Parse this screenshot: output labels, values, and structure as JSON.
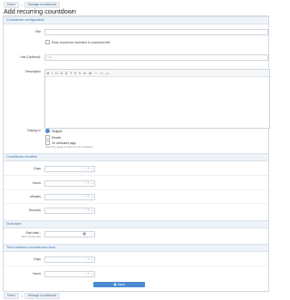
{
  "breadcrumb": {
    "home": "Home",
    "current": "Manage countdowns",
    "separator": ">"
  },
  "page_title": "Add recurring countdown",
  "sections": {
    "config": "Countdown configuration",
    "duration": "Countdown duration",
    "start": "Start date",
    "between": "Time between occurrences start"
  },
  "fields": {
    "title_label": "Title",
    "show_recurrence": "Show recurrence increment in countdown title",
    "link_label": "Link (Optional):",
    "link_placeholder": "Link...",
    "description_label": "Description",
    "display_in_label": "Display in",
    "display_options": [
      "Widgets",
      "Header",
      "On dedicated page"
    ],
    "display_hint": "Select the display locations for the countdown",
    "days_label": "Days",
    "hours_label": "Hours",
    "minutes_label": "Minutes",
    "seconds_label": "Seconds",
    "start_date_label": "Start date :",
    "start_date_hint": "Enter country time",
    "start_date_placeholder": "--:--",
    "between_days_label": "Days",
    "between_hours_label": "Hours"
  },
  "editor_toolbar": [
    "B",
    "I",
    "U",
    "S",
    "A",
    "T",
    "¶",
    "≡",
    "⊘",
    "⊞",
    "⋯",
    "⤺",
    "⤻"
  ],
  "stepper": {
    "minus": "−",
    "plus": "+",
    "chevron": "⌄"
  },
  "save_label": "Save",
  "colors": {
    "accent": "#4b8bd0",
    "section_text": "#3f79b4"
  }
}
